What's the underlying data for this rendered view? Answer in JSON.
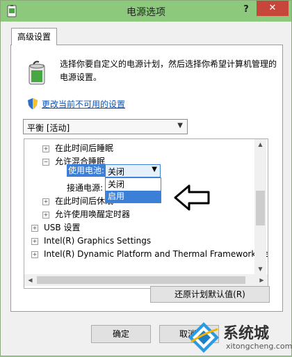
{
  "window": {
    "title": "电源选项",
    "help": "?",
    "close": "✕"
  },
  "tab": {
    "label": "高级设置"
  },
  "description": "选择你要自定义的电源计划，然后选择你希望计算机管理的电源设置。",
  "change_link": "更改当前不可用的设置",
  "plan_select": {
    "value": "平衡 [活动]"
  },
  "tree": {
    "rows": [
      {
        "expander": "+",
        "label": "在此时间后睡眠"
      },
      {
        "expander": "−",
        "label": "允许混合睡眠"
      },
      {
        "label": "使用电池:"
      },
      {
        "label": "接通电源:"
      },
      {
        "expander": "+",
        "label": "在此时间后休眠"
      },
      {
        "expander": "+",
        "label": "允许使用唤醒定时器"
      },
      {
        "expander": "+",
        "label": "USB 设置"
      },
      {
        "expander": "+",
        "label": "Intel(R) Graphics Settings"
      },
      {
        "expander": "+",
        "label": "Intel(R) Dynamic Platform and Thermal Framework Se"
      }
    ],
    "battery_combo": {
      "value": "关闭"
    },
    "dropdown_options": [
      {
        "label": "关闭",
        "selected": false
      },
      {
        "label": "启用",
        "selected": true
      }
    ]
  },
  "buttons": {
    "restore": "还原计划默认值(R)",
    "ok": "确定",
    "cancel": "取消"
  },
  "watermark": {
    "cn": "系统城",
    "en": "xitongcheng.com"
  },
  "colors": {
    "titlebar": "#8cc97d",
    "close": "#c7463c",
    "selection": "#3c7fd6",
    "link": "#0a53b5"
  }
}
